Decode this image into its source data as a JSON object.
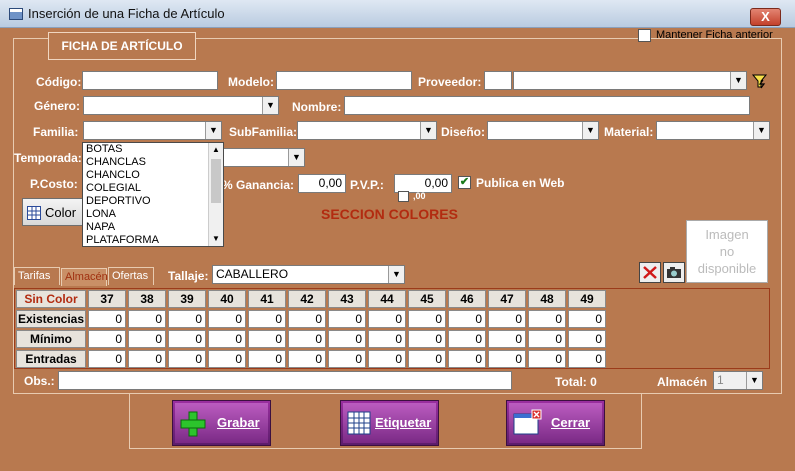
{
  "window": {
    "title": "Inserción de una Ficha de Artículo",
    "close_label": "X"
  },
  "header": {
    "tab_label": "FICHA DE ARTÍCULO",
    "keep_label": "Mantener Ficha anterior",
    "keep_checked": false
  },
  "form": {
    "codigo": {
      "label": "Código:",
      "value": ""
    },
    "modelo": {
      "label": "Modelo:",
      "value": ""
    },
    "proveedor": {
      "label": "Proveedor:",
      "code": "",
      "value": ""
    },
    "genero": {
      "label": "Género:",
      "value": ""
    },
    "nombre": {
      "label": "Nombre:",
      "value": ""
    },
    "familia": {
      "label": "Familia:",
      "value": ""
    },
    "subfamilia": {
      "label": "SubFamilia:",
      "value": ""
    },
    "diseno": {
      "label": "Diseño:",
      "value": ""
    },
    "material": {
      "label": "Material:",
      "value": ""
    },
    "temporada": {
      "label": "Temporada:",
      "value": ""
    },
    "pcosto": {
      "label": "P.Costo:"
    },
    "ganancia": {
      "label": "% Ganancia:",
      "value": "0,00"
    },
    "pvp": {
      "label": "P.V.P.:",
      "value": "0,00"
    },
    "publica": {
      "label": "Publica en Web",
      "checked": true
    },
    "decimal_label": ",00",
    "color_button": "Color"
  },
  "familia_options": [
    "BOTAS",
    "CHANCLAS",
    "CHANCLO",
    "COLEGIAL",
    "DEPORTIVO",
    "LONA",
    "NAPA",
    "PLATAFORMA"
  ],
  "section_title": "SECCION COLORES",
  "image_placeholder": [
    "Imagen",
    "no",
    "disponible"
  ],
  "tabs": [
    {
      "label": "Tarifas"
    },
    {
      "label": "Almacén"
    },
    {
      "label": "Ofertas"
    }
  ],
  "tallaje": {
    "label": "Tallaje:",
    "value": "CABALLERO"
  },
  "grid": {
    "corner": "Sin Color",
    "sizes": [
      "37",
      "38",
      "39",
      "40",
      "41",
      "42",
      "43",
      "44",
      "45",
      "46",
      "47",
      "48",
      "49"
    ],
    "rows": [
      {
        "label": "Existencias",
        "values": [
          "0",
          "0",
          "0",
          "0",
          "0",
          "0",
          "0",
          "0",
          "0",
          "0",
          "0",
          "0",
          "0"
        ]
      },
      {
        "label": "Mínimo",
        "values": [
          "0",
          "0",
          "0",
          "0",
          "0",
          "0",
          "0",
          "0",
          "0",
          "0",
          "0",
          "0",
          "0"
        ]
      },
      {
        "label": "Entradas",
        "values": [
          "0",
          "0",
          "0",
          "0",
          "0",
          "0",
          "0",
          "0",
          "0",
          "0",
          "0",
          "0",
          "0"
        ]
      }
    ]
  },
  "footer": {
    "obs_label": "Obs.:",
    "obs_value": "",
    "total_label": "Total: 0",
    "almacen_label": "Almacén",
    "almacen_value": "1"
  },
  "buttons": {
    "grabar": "Grabar",
    "etiquetar": "Etiquetar",
    "cerrar": "Cerrar"
  }
}
